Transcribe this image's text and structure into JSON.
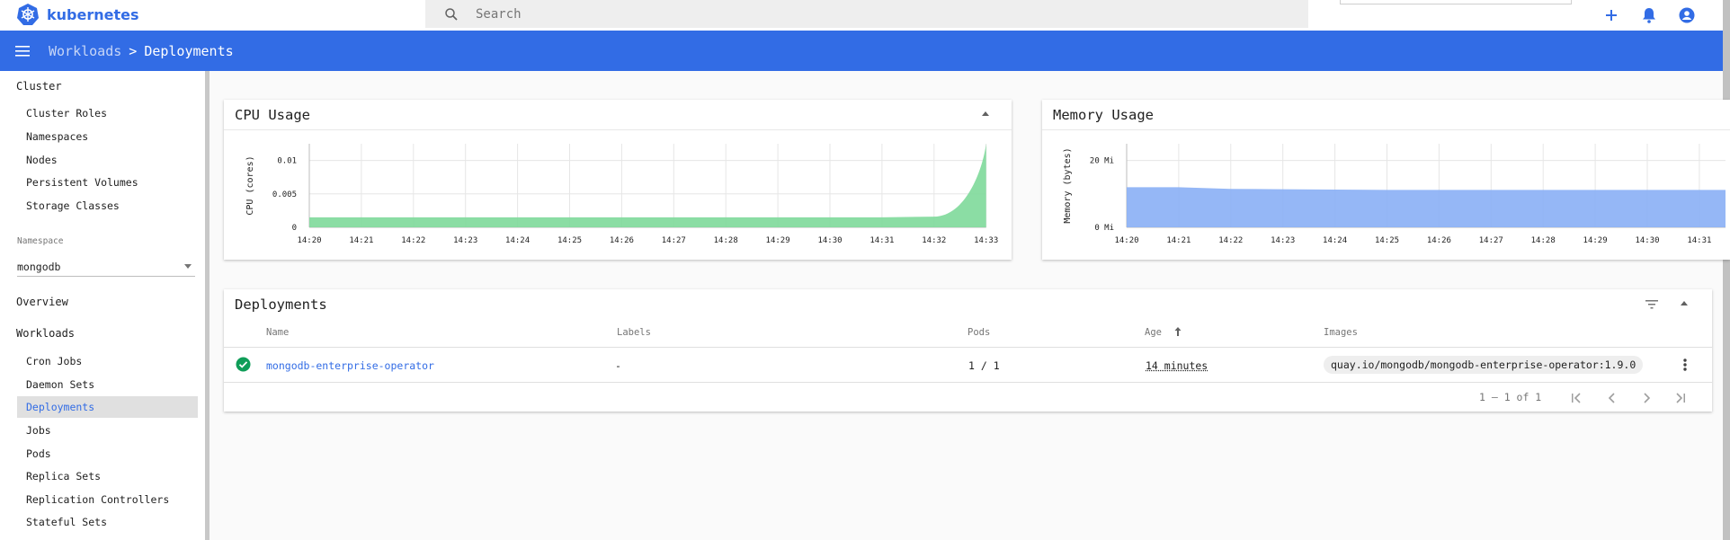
{
  "app": {
    "name": "kubernetes"
  },
  "search": {
    "placeholder": "Search"
  },
  "toolbar": {
    "parent": "Workloads",
    "separator": ">",
    "current": "Deployments"
  },
  "sidebar": {
    "cluster_title": "Cluster",
    "cluster_items": [
      "Cluster Roles",
      "Namespaces",
      "Nodes",
      "Persistent Volumes",
      "Storage Classes"
    ],
    "namespace_label": "Namespace",
    "namespace_value": "mongodb",
    "overview": "Overview",
    "workloads_title": "Workloads",
    "workload_items": [
      "Cron Jobs",
      "Daemon Sets",
      "Deployments",
      "Jobs",
      "Pods",
      "Replica Sets",
      "Replication Controllers",
      "Stateful Sets"
    ],
    "active_item": "Deployments"
  },
  "cpu_card": {
    "title": "CPU Usage"
  },
  "memory_card": {
    "title": "Memory Usage"
  },
  "chart_data": [
    {
      "type": "area",
      "title": "CPU Usage",
      "ylabel": "CPU (cores)",
      "x": [
        "14:20",
        "14:21",
        "14:22",
        "14:23",
        "14:24",
        "14:25",
        "14:26",
        "14:27",
        "14:28",
        "14:29",
        "14:30",
        "14:31",
        "14:32",
        "14:33"
      ],
      "y_ticks": [
        "0",
        "0.005",
        "0.01"
      ],
      "ylim": [
        0,
        0.0125
      ],
      "series": [
        {
          "values": [
            0.0015,
            0.0015,
            0.0015,
            0.0015,
            0.0015,
            0.0015,
            0.0015,
            0.0015,
            0.0015,
            0.0015,
            0.0015,
            0.0015,
            0.0016,
            0.0125
          ]
        }
      ],
      "color": "#7ed99a",
      "grid": true
    },
    {
      "type": "area",
      "title": "Memory Usage",
      "ylabel": "Memory (bytes)",
      "x": [
        "14:20",
        "14:21",
        "14:22",
        "14:23",
        "14:24",
        "14:25",
        "14:26",
        "14:27",
        "14:28",
        "14:29",
        "14:30",
        "14:31"
      ],
      "y_ticks": [
        "0 Mi",
        "20 Mi"
      ],
      "ylim": [
        0,
        25
      ],
      "series": [
        {
          "values": [
            12,
            12,
            11.5,
            11.4,
            11.3,
            11.2,
            11.2,
            11.2,
            11.2,
            11.2,
            11.2,
            11.2
          ]
        }
      ],
      "color": "#8aaff5",
      "grid": true
    }
  ],
  "deployments": {
    "title": "Deployments",
    "columns": [
      "Name",
      "Labels",
      "Pods",
      "Age",
      "Images"
    ],
    "rows": [
      {
        "name": "mongodb-enterprise-operator",
        "labels": "-",
        "pods": "1 / 1",
        "age": "14 minutes",
        "image": "quay.io/mongodb/mongodb-enterprise-operator:1.9.0"
      }
    ],
    "pagination": "1 – 1 of 1"
  },
  "colors": {
    "brand": "#326ce5",
    "success": "#0f9d58",
    "cpu_area": "#7ed99a",
    "memory_area": "#8aaff5"
  }
}
